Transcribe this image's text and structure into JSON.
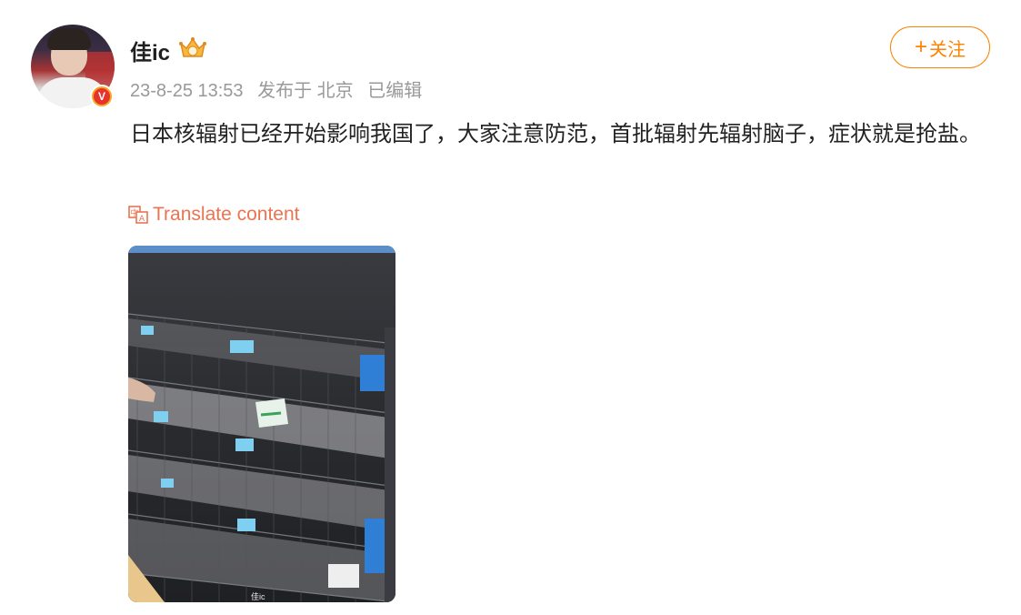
{
  "post": {
    "author": {
      "name": "佳ic",
      "verified_badge": "V"
    },
    "meta": {
      "time": "23-8-25 13:53",
      "location": "发布于 北京",
      "edited": "已编辑"
    },
    "follow_label": "关注",
    "content": "日本核辐射已经开始影响我国了，大家注意防范，首批辐射先辐射脑子，症状就是抢盐。",
    "translate_label": "Translate content",
    "image": {
      "description_icon": "photo",
      "watermark": "佳ic"
    }
  },
  "colors": {
    "accent": "#ff8200",
    "link": "#eb7350",
    "meta": "#999999"
  }
}
